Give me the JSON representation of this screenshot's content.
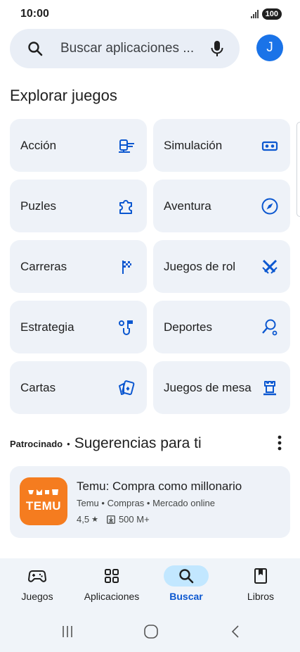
{
  "status_bar": {
    "time": "10:00",
    "battery": "100"
  },
  "search": {
    "placeholder": "Buscar aplicaciones ...",
    "avatar_letter": "J"
  },
  "explore": {
    "title": "Explorar juegos",
    "categories": [
      {
        "label": "Acción",
        "icon": "helicopter-icon"
      },
      {
        "label": "Simulación",
        "icon": "vr-headset-icon"
      },
      {
        "label": "Puzles",
        "icon": "puzzle-icon"
      },
      {
        "label": "Aventura",
        "icon": "compass-icon"
      },
      {
        "label": "Carreras",
        "icon": "checkered-flag-icon"
      },
      {
        "label": "Juegos de rol",
        "icon": "crossed-swords-icon"
      },
      {
        "label": "Estrategia",
        "icon": "strategy-flag-icon"
      },
      {
        "label": "Deportes",
        "icon": "racket-icon"
      },
      {
        "label": "Cartas",
        "icon": "playing-cards-icon"
      },
      {
        "label": "Juegos de mesa",
        "icon": "chess-rook-icon"
      }
    ]
  },
  "suggestions": {
    "sponsored": "Patrocinado",
    "separator": "•",
    "title": "Sugerencias para ti",
    "app": {
      "name": "Temu: Compra como millonario",
      "meta": "Temu • Compras • Mercado online",
      "rating": "4,5",
      "downloads": "500 M+",
      "icon_word": "TEMU",
      "icon_color": "#f57c1f"
    }
  },
  "bottom_nav": {
    "items": [
      {
        "label": "Juegos",
        "icon": "gamepad-icon",
        "active": false
      },
      {
        "label": "Aplicaciones",
        "icon": "apps-grid-icon",
        "active": false
      },
      {
        "label": "Buscar",
        "icon": "search-icon",
        "active": true
      },
      {
        "label": "Libros",
        "icon": "book-icon",
        "active": false
      }
    ]
  },
  "colors": {
    "accent": "#0b57d0",
    "active_pill": "#c2e7ff",
    "card_bg": "#eef2f8",
    "avatar": "#1a73e8"
  }
}
